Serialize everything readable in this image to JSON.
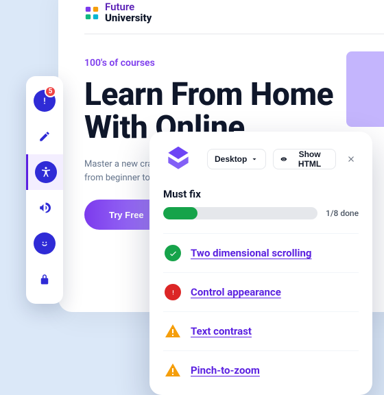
{
  "site": {
    "brand_line1": "Future",
    "brand_line2": "University",
    "eyebrow": "100's of courses",
    "headline": "Learn From Home With Online",
    "sub": "Master a new craft or subject with courses ranging from beginner to advanced.",
    "cta": "Try Free"
  },
  "toolbar": {
    "items": [
      {
        "name": "alerts",
        "badge": "5"
      },
      {
        "name": "edit"
      },
      {
        "name": "accessibility"
      },
      {
        "name": "megaphone"
      },
      {
        "name": "feedback"
      },
      {
        "name": "lock"
      }
    ]
  },
  "panel": {
    "viewport": "Desktop",
    "show_html": "Show HTML",
    "mustfix_heading": "Must fix",
    "done_count": 1,
    "total_count": 8,
    "progress_text": "1/8 done",
    "progress_pct": 22,
    "issues": [
      {
        "status": "ok",
        "label": "Two dimensional scrolling"
      },
      {
        "status": "err",
        "label": "Control appearance"
      },
      {
        "status": "warn",
        "label": "Text contrast"
      },
      {
        "status": "warn",
        "label": "Pinch-to-zoom"
      }
    ]
  },
  "colors": {
    "accent_purple": "#5b21e0",
    "success": "#16a34a",
    "error": "#dc2626",
    "warning": "#f59e0b"
  }
}
